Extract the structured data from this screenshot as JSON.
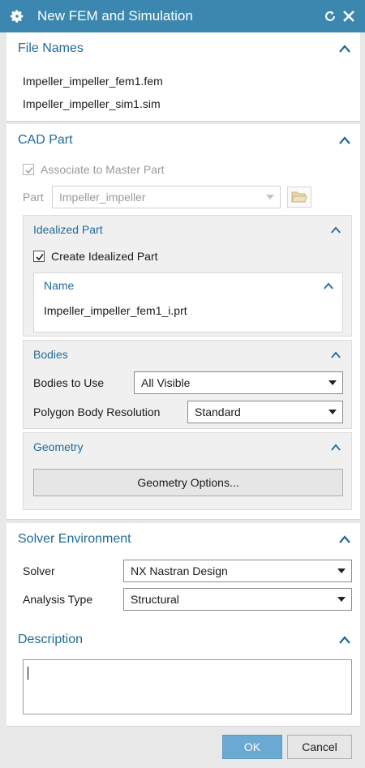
{
  "window": {
    "title": "New FEM and Simulation"
  },
  "file_names": {
    "header": "File Names",
    "fem": "Impeller_impeller_fem1.fem",
    "sim": "Impeller_impeller_sim1.sim"
  },
  "cad_part": {
    "header": "CAD Part",
    "associate_label": "Associate to Master Part",
    "part_label": "Part",
    "part_value": "Impeller_impeller",
    "idealized": {
      "header": "Idealized Part",
      "create_label": "Create Idealized Part",
      "name_header": "Name",
      "name_value": "Impeller_impeller_fem1_i.prt"
    },
    "bodies": {
      "header": "Bodies",
      "bodies_to_use_label": "Bodies to Use",
      "bodies_to_use_value": "All Visible",
      "polygon_label": "Polygon Body Resolution",
      "polygon_value": "Standard"
    },
    "geometry": {
      "header": "Geometry",
      "options_button": "Geometry Options..."
    }
  },
  "solver_env": {
    "header": "Solver Environment",
    "solver_label": "Solver",
    "solver_value": "NX Nastran Design",
    "analysis_label": "Analysis Type",
    "analysis_value": "Structural"
  },
  "description": {
    "header": "Description",
    "value": ""
  },
  "footer": {
    "ok": "OK",
    "cancel": "Cancel"
  },
  "colors": {
    "titlebar": "#3c87b0",
    "header_text": "#1f6b99",
    "ok_button": "#69a9d2"
  }
}
